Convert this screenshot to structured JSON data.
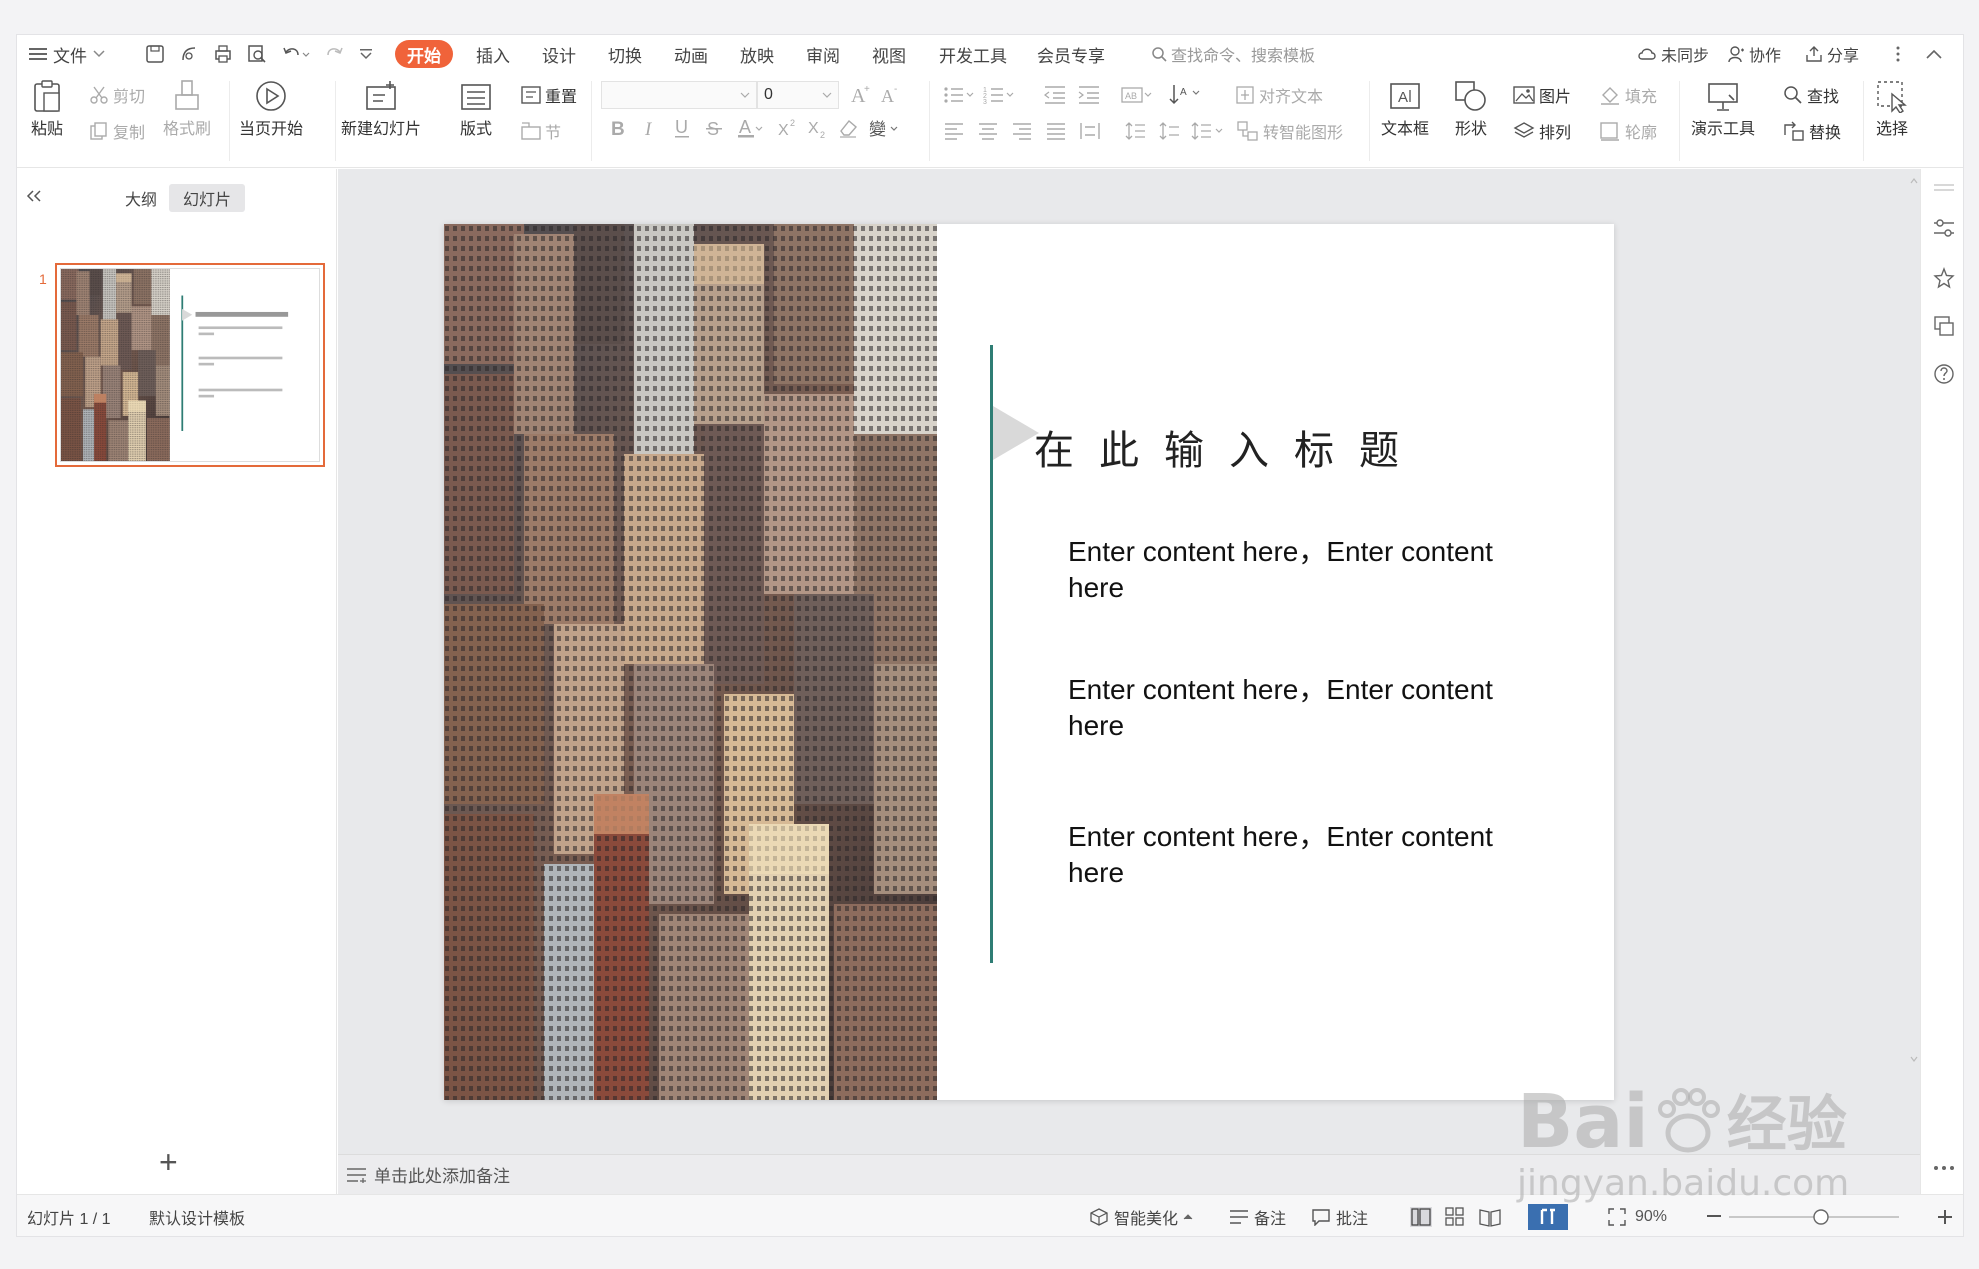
{
  "menubar": {
    "file_label": "文件",
    "tabs": [
      {
        "label": "开始",
        "active": true
      },
      {
        "label": "插入"
      },
      {
        "label": "设计"
      },
      {
        "label": "切换"
      },
      {
        "label": "动画"
      },
      {
        "label": "放映"
      },
      {
        "label": "审阅"
      },
      {
        "label": "视图"
      },
      {
        "label": "开发工具"
      },
      {
        "label": "会员专享"
      }
    ],
    "search_placeholder": "查找命令、搜索模板",
    "sync_label": "未同步",
    "collab_label": "协作",
    "share_label": "分享"
  },
  "ribbon": {
    "paste": "粘贴",
    "cut": "剪切",
    "copy": "复制",
    "format_painter": "格式刷",
    "play_current": "当页开始",
    "new_slide": "新建幻灯片",
    "layout": "版式",
    "reset": "重置",
    "section": "节",
    "font_size_value": "0",
    "align_text": "对齐文本",
    "to_smartart": "转智能图形",
    "textbox": "文本框",
    "shape": "形状",
    "picture": "图片",
    "arrange": "排列",
    "fill": "填充",
    "outline": "轮廓",
    "present_tools": "演示工具",
    "find": "查找",
    "replace": "替换",
    "select": "选择"
  },
  "left_panel": {
    "tab_outline": "大纲",
    "tab_slides": "幻灯片",
    "slide_number": "1",
    "add_symbol": "+"
  },
  "slide": {
    "title": "在此输入标题",
    "bullets": [
      "Enter content here，Enter content here",
      "Enter content here，Enter content here",
      "Enter content here，Enter content here"
    ]
  },
  "notes": {
    "placeholder": "单击此处添加备注"
  },
  "statusbar": {
    "slide_counter": "幻灯片 1 / 1",
    "template": "默认设计模板",
    "beautify": "智能美化",
    "notes": "备注",
    "comments": "批注",
    "zoom": "90%"
  },
  "watermark": {
    "brand": "Bai",
    "brand_cn": "经验",
    "url": "jingyan.baidu.com"
  },
  "colors": {
    "accent": "#f0633a",
    "slide_line": "#2e7d74",
    "thumb_border": "#e46a3a"
  }
}
